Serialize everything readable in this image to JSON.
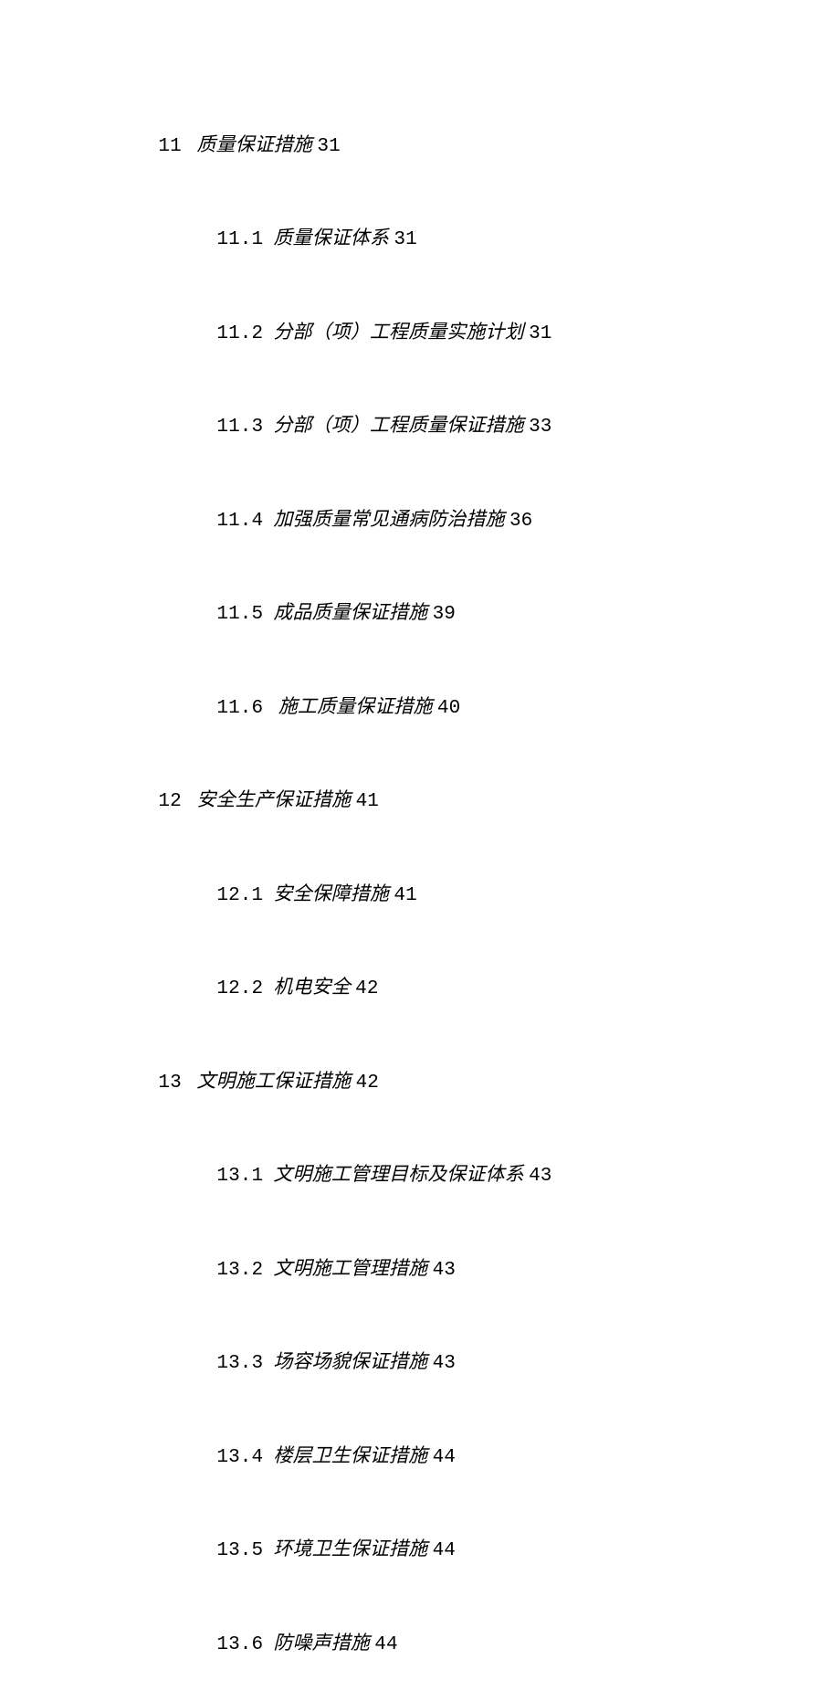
{
  "toc": {
    "sections": [
      {
        "number": "11",
        "title": "质量保证措施",
        "page": "31",
        "subs": [
          {
            "number": "11.1",
            "title": "质量保证体系",
            "page": "31"
          },
          {
            "number": "11.2",
            "title": "分部（项）工程质量实施计划",
            "page": "31"
          },
          {
            "number": "11.3",
            "title": "分部（项）工程质量保证措施",
            "page": "33"
          },
          {
            "number": "11.4",
            "title": "加强质量常见通病防治措施",
            "page": "36"
          },
          {
            "number": "11.5",
            "title": "成品质量保证措施",
            "page": "39"
          },
          {
            "number": "11.6",
            "title": " 施工质量保证措施",
            "page": "40"
          }
        ]
      },
      {
        "number": "12",
        "title": "安全生产保证措施",
        "page": "41",
        "subs": [
          {
            "number": "12.1",
            "title": "安全保障措施",
            "page": "41"
          },
          {
            "number": "12.2",
            "title": "机电安全",
            "page": "42"
          }
        ]
      },
      {
        "number": "13",
        "title": "文明施工保证措施",
        "page": "42",
        "subs": [
          {
            "number": "13.1",
            "title": "文明施工管理目标及保证体系",
            "page": "43"
          },
          {
            "number": "13.2",
            "title": "文明施工管理措施",
            "page": "43"
          },
          {
            "number": "13.3",
            "title": "场容场貌保证措施",
            "page": "43"
          },
          {
            "number": "13.4",
            "title": "楼层卫生保证措施",
            "page": "44"
          },
          {
            "number": "13.5",
            "title": "环境卫生保证措施",
            "page": "44"
          },
          {
            "number": "13.6",
            "title": "防噪声措施",
            "page": "44"
          }
        ]
      }
    ]
  }
}
